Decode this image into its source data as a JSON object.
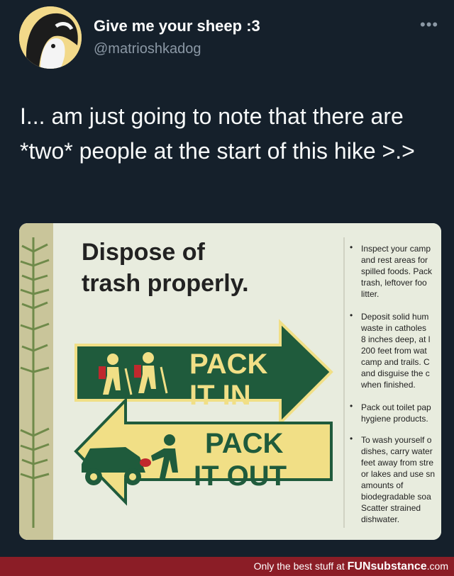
{
  "tweet": {
    "display_name": "Give me your sheep :3",
    "handle": "@matrioshkadog",
    "more_icon": "more-horizontal-icon",
    "text": "I... am just going to note that there are *two* people at the start of this hike >.>"
  },
  "photo": {
    "sign_title_line1": "Dispose of",
    "sign_title_line2": "trash properly.",
    "arrow_top_line1": "PACK",
    "arrow_top_line2": "IT IN",
    "arrow_bottom_line1": "PACK",
    "arrow_bottom_line2": "IT OUT",
    "bullets": [
      [
        "Inspect your camp",
        "and rest areas for",
        "spilled foods. Pack",
        "trash, leftover foo",
        "litter."
      ],
      [
        "Deposit solid hum",
        "waste in catholes",
        "8 inches deep, at l",
        "200 feet from wat",
        "camp and trails. C",
        "and disguise the c",
        "when finished."
      ],
      [
        "Pack out toilet pap",
        "hygiene products."
      ],
      [
        "To wash yourself o",
        "dishes, carry water",
        "feet away from stre",
        "or lakes and use sn",
        "amounts of",
        "biodegradable soa",
        "Scatter strained",
        "dishwater."
      ]
    ],
    "colors": {
      "green": "#1f5b3c",
      "yellow": "#f1df86",
      "sign_bg": "#e8ecde"
    }
  },
  "footer": {
    "prefix": "Only the best stuff at ",
    "brand": "FUNsubstance",
    "suffix": ".com"
  }
}
